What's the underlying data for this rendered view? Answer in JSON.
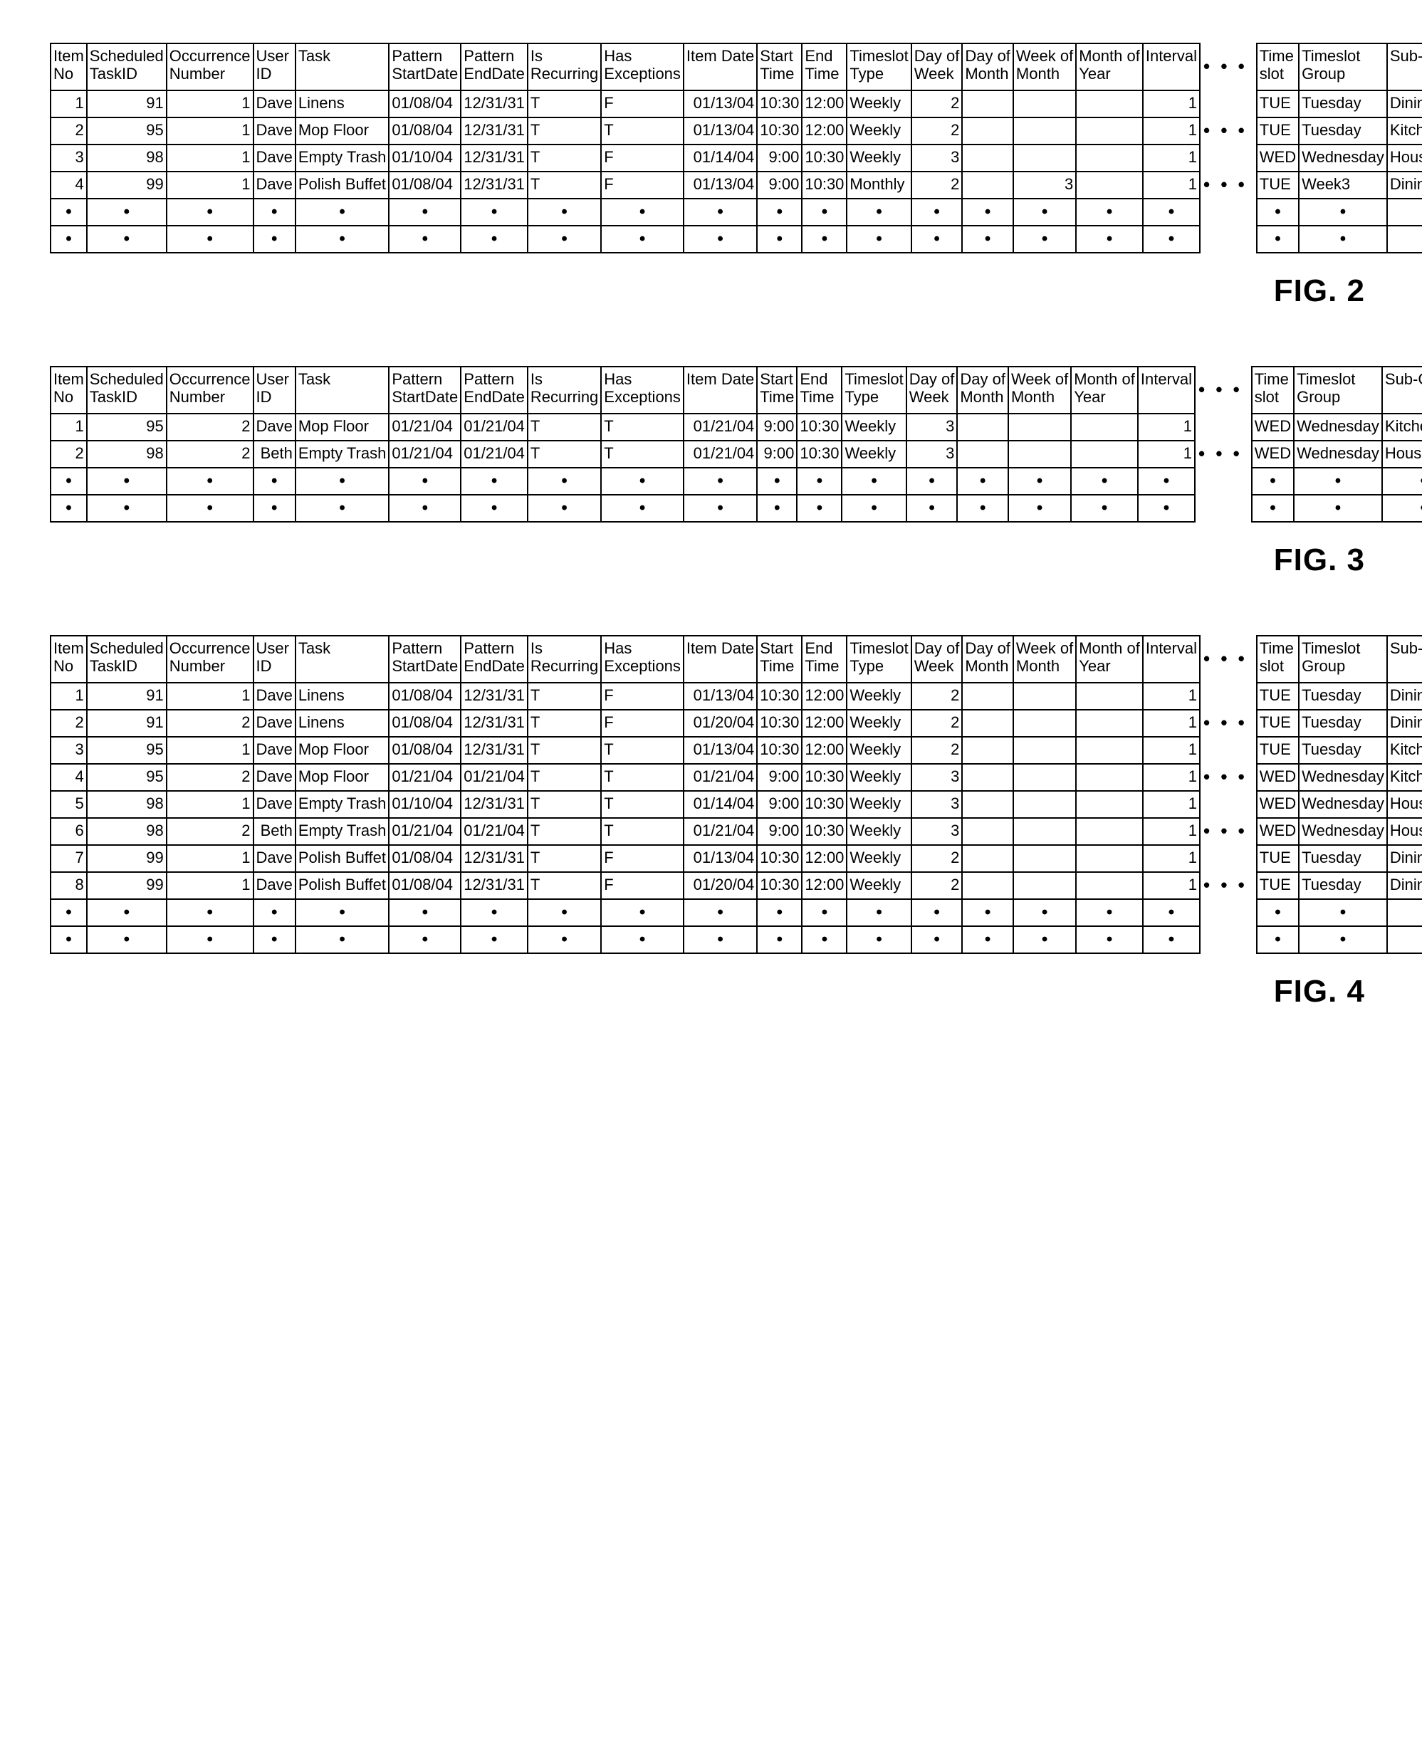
{
  "headers_main": [
    [
      "Item",
      "No"
    ],
    [
      "Scheduled",
      "TaskID"
    ],
    [
      "Occurrence",
      "Number"
    ],
    [
      "User",
      "ID"
    ],
    [
      "",
      "Task"
    ],
    [
      "Pattern",
      "StartDate"
    ],
    [
      "Pattern",
      "EndDate"
    ],
    [
      "Is",
      "Recurring"
    ],
    [
      "Has",
      "Exceptions"
    ],
    [
      "",
      "Item Date"
    ],
    [
      "Start",
      "Time"
    ],
    [
      "End",
      "Time"
    ],
    [
      "Timeslot",
      "Type"
    ],
    [
      "Day of",
      "Week"
    ],
    [
      "Day of",
      "Month"
    ],
    [
      "Week of",
      "Month"
    ],
    [
      "Month of",
      "Year"
    ],
    [
      "",
      "Interval"
    ]
  ],
  "headers_side": [
    [
      "Time",
      "slot"
    ],
    [
      "Timeslot",
      "Group"
    ],
    [
      "",
      "Sub-Group"
    ]
  ],
  "num_cols_main": [
    0,
    1,
    2,
    3,
    9,
    10,
    11,
    13,
    14,
    15,
    16,
    17
  ],
  "figures": [
    {
      "caption": "FIG. 2",
      "rows_main": [
        [
          "1",
          "91",
          "1",
          "Dave",
          "Linens",
          "01/08/04",
          "12/31/31",
          "T",
          "F",
          "01/13/04",
          "10:30",
          "12:00",
          "Weekly",
          "2",
          "",
          "",
          "",
          "1"
        ],
        [
          "2",
          "95",
          "1",
          "Dave",
          "Mop Floor",
          "01/08/04",
          "12/31/31",
          "T",
          "T",
          "01/13/04",
          "10:30",
          "12:00",
          "Weekly",
          "2",
          "",
          "",
          "",
          "1"
        ],
        [
          "3",
          "98",
          "1",
          "Dave",
          "Empty Trash",
          "01/10/04",
          "12/31/31",
          "T",
          "F",
          "01/14/04",
          "9:00",
          "10:30",
          "Weekly",
          "3",
          "",
          "",
          "",
          "1"
        ],
        [
          "4",
          "99",
          "1",
          "Dave",
          "Polish Buffet",
          "01/08/04",
          "12/31/31",
          "T",
          "F",
          "01/13/04",
          "9:00",
          "10:30",
          "Monthly",
          "2",
          "",
          "3",
          "",
          "1"
        ]
      ],
      "rows_side": [
        [
          "TUE",
          "Tuesday",
          "Dining Rm"
        ],
        [
          "TUE",
          "Tuesday",
          "Kitchen"
        ],
        [
          "WED",
          "Wednesday",
          "House"
        ],
        [
          "TUE",
          "Week3",
          "Dining Rm"
        ]
      ],
      "row_ellipsis": [
        false,
        true,
        false,
        true
      ]
    },
    {
      "caption": "FIG. 3",
      "rows_main": [
        [
          "1",
          "95",
          "2",
          "Dave",
          "Mop Floor",
          "01/21/04",
          "01/21/04",
          "T",
          "T",
          "01/21/04",
          "9:00",
          "10:30",
          "Weekly",
          "3",
          "",
          "",
          "",
          "1"
        ],
        [
          "2",
          "98",
          "2",
          "Beth",
          "Empty Trash",
          "01/21/04",
          "01/21/04",
          "T",
          "T",
          "01/21/04",
          "9:00",
          "10:30",
          "Weekly",
          "3",
          "",
          "",
          "",
          "1"
        ]
      ],
      "rows_side": [
        [
          "WED",
          "Wednesday",
          "Kitchen"
        ],
        [
          "WED",
          "Wednesday",
          "House"
        ]
      ],
      "row_ellipsis": [
        false,
        true
      ]
    },
    {
      "caption": "FIG. 4",
      "rows_main": [
        [
          "1",
          "91",
          "1",
          "Dave",
          "Linens",
          "01/08/04",
          "12/31/31",
          "T",
          "F",
          "01/13/04",
          "10:30",
          "12:00",
          "Weekly",
          "2",
          "",
          "",
          "",
          "1"
        ],
        [
          "2",
          "91",
          "2",
          "Dave",
          "Linens",
          "01/08/04",
          "12/31/31",
          "T",
          "F",
          "01/20/04",
          "10:30",
          "12:00",
          "Weekly",
          "2",
          "",
          "",
          "",
          "1"
        ],
        [
          "3",
          "95",
          "1",
          "Dave",
          "Mop Floor",
          "01/08/04",
          "12/31/31",
          "T",
          "T",
          "01/13/04",
          "10:30",
          "12:00",
          "Weekly",
          "2",
          "",
          "",
          "",
          "1"
        ],
        [
          "4",
          "95",
          "2",
          "Dave",
          "Mop Floor",
          "01/21/04",
          "01/21/04",
          "T",
          "T",
          "01/21/04",
          "9:00",
          "10:30",
          "Weekly",
          "3",
          "",
          "",
          "",
          "1"
        ],
        [
          "5",
          "98",
          "1",
          "Dave",
          "Empty Trash",
          "01/10/04",
          "12/31/31",
          "T",
          "T",
          "01/14/04",
          "9:00",
          "10:30",
          "Weekly",
          "3",
          "",
          "",
          "",
          "1"
        ],
        [
          "6",
          "98",
          "2",
          "Beth",
          "Empty Trash",
          "01/21/04",
          "01/21/04",
          "T",
          "T",
          "01/21/04",
          "9:00",
          "10:30",
          "Weekly",
          "3",
          "",
          "",
          "",
          "1"
        ],
        [
          "7",
          "99",
          "1",
          "Dave",
          "Polish Buffet",
          "01/08/04",
          "12/31/31",
          "T",
          "F",
          "01/13/04",
          "10:30",
          "12:00",
          "Weekly",
          "2",
          "",
          "",
          "",
          "1"
        ],
        [
          "8",
          "99",
          "1",
          "Dave",
          "Polish Buffet",
          "01/08/04",
          "12/31/31",
          "T",
          "F",
          "01/20/04",
          "10:30",
          "12:00",
          "Weekly",
          "2",
          "",
          "",
          "",
          "1"
        ]
      ],
      "rows_side": [
        [
          "TUE",
          "Tuesday",
          "Dining Rm"
        ],
        [
          "TUE",
          "Tuesday",
          "Dining Rm"
        ],
        [
          "TUE",
          "Tuesday",
          "Kitchen"
        ],
        [
          "WED",
          "Wednesday",
          "Kitchen"
        ],
        [
          "WED",
          "Wednesday",
          "House"
        ],
        [
          "WED",
          "Wednesday",
          "House"
        ],
        [
          "TUE",
          "Tuesday",
          "Dining Rm"
        ],
        [
          "TUE",
          "Tuesday",
          "Dining Rm"
        ]
      ],
      "row_ellipsis": [
        false,
        true,
        false,
        true,
        false,
        true,
        false,
        true
      ]
    }
  ],
  "dot_char": "•",
  "gap_ellipsis": "• • •"
}
